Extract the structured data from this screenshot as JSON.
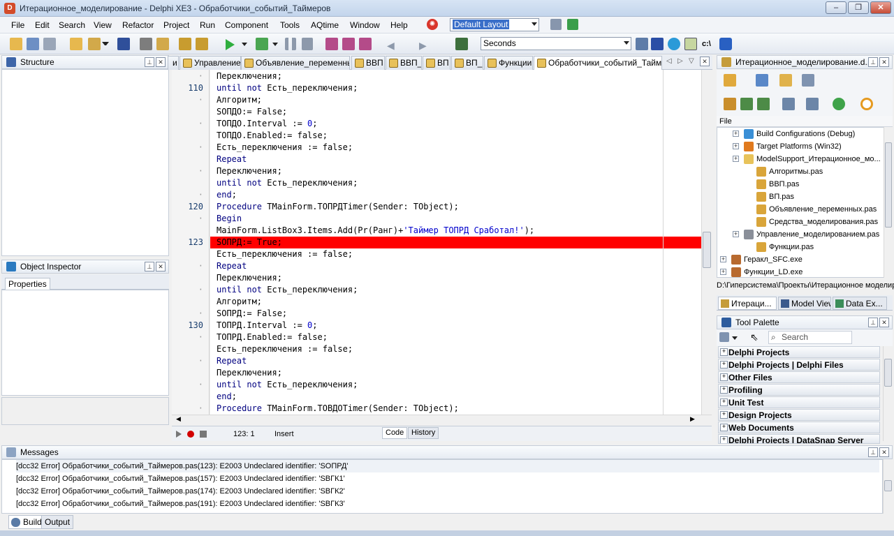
{
  "window": {
    "title": "Итерационное_моделирование - Delphi XE3 - Обработчики_событий_Таймеров",
    "app_icon": "delphi-icon"
  },
  "menu": [
    "File",
    "Edit",
    "Search",
    "View",
    "Refactor",
    "Project",
    "Run",
    "Component",
    "Tools",
    "AQtime",
    "Window",
    "Help"
  ],
  "toolbar": {
    "layout_combo": "Default Layout",
    "seconds_combo": "Seconds"
  },
  "structure": {
    "title": "Structure"
  },
  "object_inspector": {
    "title": "Object Inspector",
    "tab": "Properties"
  },
  "editor": {
    "tabs": [
      "и",
      "Управление",
      "Объявление_переменных",
      "ВВП",
      "ВВП_",
      "ВП",
      "ВП_",
      "Функции",
      "Обработчики_событий_Таймер"
    ],
    "active_tab": 8,
    "lines": [
      {
        "n": "",
        "t": "Переключения;",
        "kw": false,
        "hl": false
      },
      {
        "n": "110",
        "t": "until not Есть_переключения;",
        "hl": false
      },
      {
        "n": "",
        "t": "Алгоритм;",
        "hl": false
      },
      {
        "n": "",
        "t": "SOПДО:= False;",
        "hl": false
      },
      {
        "n": "",
        "t": "ТОПДО.Interval := 0;",
        "hl": false
      },
      {
        "n": "",
        "t": "ТОПДО.Enabled:= false;",
        "hl": false
      },
      {
        "n": "",
        "t": "Есть_переключения := false;",
        "hl": false
      },
      {
        "n": "",
        "t": "Repeat",
        "hl": false
      },
      {
        "n": "",
        "t": "Переключения;",
        "hl": false
      },
      {
        "n": "",
        "t": "until not Есть_переключения;",
        "hl": false
      },
      {
        "n": "",
        "t": "end;",
        "hl": false
      },
      {
        "n": "120",
        "t": "Procedure TMainForm.ТОПРДTimer(Sender: TObject);",
        "hl": false
      },
      {
        "n": "",
        "t": "Begin",
        "hl": false
      },
      {
        "n": "",
        "t": "MainForm.ListBox3.Items.Add(Pr(Ранг)+'Таймер ТОПРД Сработал!');",
        "hl": false
      },
      {
        "n": "123",
        "t": "SOПРД:= True;",
        "hl": true
      },
      {
        "n": "",
        "t": "Есть_переключения := false;",
        "hl": false
      },
      {
        "n": "",
        "t": "Repeat",
        "hl": false
      },
      {
        "n": "",
        "t": "Переключения;",
        "hl": false
      },
      {
        "n": "",
        "t": "until not Есть_переключения;",
        "hl": false
      },
      {
        "n": "",
        "t": "Алгоритм;",
        "hl": false
      },
      {
        "n": "",
        "t": "SOПРД:= False;",
        "hl": false
      },
      {
        "n": "130",
        "t": "ТОПРД.Interval := 0;",
        "hl": false
      },
      {
        "n": "",
        "t": "ТОПРД.Enabled:= false;",
        "hl": false
      },
      {
        "n": "",
        "t": "Есть_переключения := false;",
        "hl": false
      },
      {
        "n": "",
        "t": "Repeat",
        "hl": false
      },
      {
        "n": "",
        "t": "Переключения;",
        "hl": false
      },
      {
        "n": "",
        "t": "until not Есть_переключения;",
        "hl": false
      },
      {
        "n": "",
        "t": "end;",
        "hl": false
      },
      {
        "n": "",
        "t": "Procedure TMainForm.ТОВДОTimer(Sender: TObject);",
        "hl": false
      }
    ],
    "highlight_color": "#ff0000",
    "status": {
      "position": "123:  1",
      "mode": "Insert",
      "code_tab": "Code",
      "history_tab": "History"
    }
  },
  "project": {
    "title": "Итерационное_моделирование.d...",
    "column": "File",
    "items": [
      {
        "label": "Build Configurations (Debug)",
        "level": 1,
        "exp": "+",
        "icon": "build-config-icon"
      },
      {
        "label": "Target Platforms (Win32)",
        "level": 1,
        "exp": "+",
        "icon": "target-platform-icon"
      },
      {
        "label": "ModelSupport_Итерационное_мо...",
        "level": 1,
        "exp": "+",
        "icon": "folder-icon"
      },
      {
        "label": "Алгоритмы.pas",
        "level": 2,
        "exp": "",
        "icon": "pas-file-icon"
      },
      {
        "label": "ВВП.pas",
        "level": 2,
        "exp": "",
        "icon": "pas-file-icon"
      },
      {
        "label": "ВП.pas",
        "level": 2,
        "exp": "",
        "icon": "pas-file-icon"
      },
      {
        "label": "Объявление_переменных.pas",
        "level": 2,
        "exp": "",
        "icon": "pas-file-icon"
      },
      {
        "label": "Средства_моделирования.pas",
        "level": 2,
        "exp": "",
        "icon": "pas-file-icon"
      },
      {
        "label": "Управление_моделированием.pas",
        "level": 1,
        "exp": "+",
        "icon": "form-file-icon"
      },
      {
        "label": "Функции.pas",
        "level": 2,
        "exp": "",
        "icon": "pas-file-icon"
      },
      {
        "label": "Геракл_SFC.exe",
        "level": 0,
        "exp": "+",
        "icon": "exe-icon"
      },
      {
        "label": "Функции_LD.exe",
        "level": 0,
        "exp": "+",
        "icon": "exe-icon"
      }
    ],
    "path": "D:\\Гиперсистема\\Проекты\\Итерационное моделир",
    "tabs": [
      "Итераци...",
      "Model View",
      "Data Ex..."
    ]
  },
  "palette": {
    "title": "Tool Palette",
    "search_placeholder": "Search",
    "categories": [
      "Delphi Projects",
      "Delphi Projects | Delphi Files",
      "Other Files",
      "Profiling",
      "Unit Test",
      "Design Projects",
      "Web Documents",
      "Delphi Projects | DataSnap Server"
    ]
  },
  "messages": {
    "title": "Messages",
    "items": [
      "[dcc32 Error] Обработчики_событий_Таймеров.pas(123): E2003 Undeclared identifier: 'SOПРД'",
      "[dcc32 Error] Обработчики_событий_Таймеров.pas(157): E2003 Undeclared identifier: 'SBГК1'",
      "[dcc32 Error] Обработчики_событий_Таймеров.pas(174): E2003 Undeclared identifier: 'SBГК2'",
      "[dcc32 Error] Обработчики_событий_Таймеров.pas(191): E2003 Undeclared identifier: 'SBГК3'"
    ],
    "tabs": [
      "Build",
      "Output"
    ]
  }
}
